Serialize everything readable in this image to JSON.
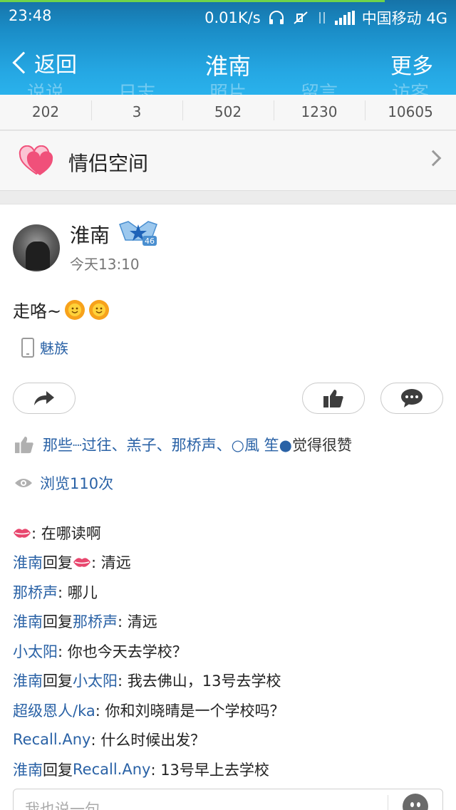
{
  "status_bar": {
    "time": "23:48",
    "net_speed": "0.01K/s",
    "carrier": "中国移动 4G"
  },
  "nav": {
    "back_label": "返回",
    "title": "淮南",
    "more_label": "更多"
  },
  "stats": [
    {
      "label": "说说",
      "value": "202"
    },
    {
      "label": "日志",
      "value": "3"
    },
    {
      "label": "照片",
      "value": "502"
    },
    {
      "label": "留言",
      "value": "1230"
    },
    {
      "label": "访客",
      "value": "10605"
    }
  ],
  "couple_space": {
    "label": "情侣空间"
  },
  "post": {
    "author": "淮南",
    "vip_level": "46",
    "time": "今天13:10",
    "text": "走咯~",
    "device": "魅族",
    "likes_names": "那些┈过往、羔子、那桥声、○風 笙●",
    "likes_suffix": "觉得很赞",
    "views": "浏览110次"
  },
  "comments": [
    {
      "user": "",
      "lips": true,
      "reply_to": "",
      "reply_lips": false,
      "text": ": 在哪读啊"
    },
    {
      "user": "淮南",
      "lips": false,
      "reply_word": "回复",
      "reply_to": "",
      "reply_lips": true,
      "text": ": 清远"
    },
    {
      "user": "那桥声",
      "lips": false,
      "reply_to": "",
      "reply_lips": false,
      "text": ": 哪儿"
    },
    {
      "user": "淮南",
      "lips": false,
      "reply_word": "回复",
      "reply_to": "那桥声",
      "reply_lips": false,
      "text": ": 清远"
    },
    {
      "user": "小太阳",
      "lips": false,
      "reply_to": "",
      "reply_lips": false,
      "text": ": 你也今天去学校？"
    },
    {
      "user": "淮南",
      "lips": false,
      "reply_word": "回复",
      "reply_to": "小太阳",
      "reply_lips": false,
      "text": ": 我去佛山，13号去学校"
    },
    {
      "user": "超级恩人/ka",
      "lips": false,
      "reply_to": "",
      "reply_lips": false,
      "text": ": 你和刘晓晴是一个学校吗？"
    },
    {
      "user": "Recall.Any",
      "lips": false,
      "reply_to": "",
      "reply_lips": false,
      "text": ": 什么时候出发？"
    },
    {
      "user": "淮南",
      "lips": false,
      "reply_word": "回复",
      "reply_to": "Recall.Any",
      "reply_lips": false,
      "text": ": 13号早上去学校"
    }
  ],
  "comment_input": {
    "placeholder": "我也说一句"
  },
  "colors": {
    "header_top": "#1673a8",
    "header_bottom": "#2ab2ec",
    "link_blue": "#2a62a6",
    "heart_pink": "#f0507a"
  },
  "icons": [
    "back-chevron-icon",
    "headphone-icon",
    "mute-icon",
    "data-arrows-icon",
    "signal-icon",
    "heart-icon",
    "chevron-right-icon",
    "vip-badge-icon",
    "sun-emoji-icon",
    "phone-icon",
    "share-icon",
    "thumbs-up-icon",
    "comment-icon",
    "eye-icon",
    "lips-emoji-icon",
    "emoji-icon"
  ]
}
